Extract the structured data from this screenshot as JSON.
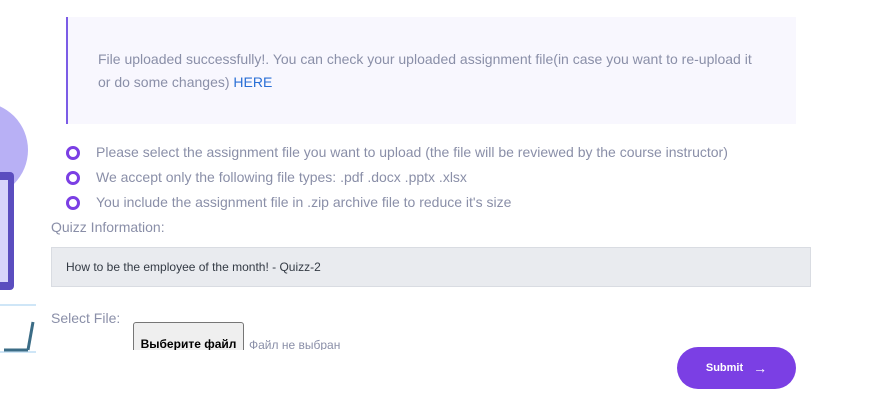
{
  "notice": {
    "message": "File uploaded successfully!. You can check your uploaded assignment file(in case you want to re-upload it or do some changes)",
    "link_label": "HERE"
  },
  "instructions": [
    "Please select the assignment file you want to upload (the file will be reviewed by the course instructor)",
    "We accept only the following file types: .pdf .docx .pptx .xlsx",
    "You include the assignment file in .zip archive file to reduce it's size"
  ],
  "quiz_info": {
    "label": "Quizz Information:",
    "value": "How to be the employee of the month! - Quizz-2"
  },
  "file_select": {
    "label": "Select File:",
    "button_label": "Выберите файл",
    "status": "Файл не выбран"
  },
  "submit": {
    "label": "Submit",
    "icon": "arrow-right-icon"
  },
  "colors": {
    "accent": "#7b3fe4",
    "link": "#2a6fd6",
    "text": "#8a8fa8",
    "notice_bg": "#f8f7fe"
  }
}
